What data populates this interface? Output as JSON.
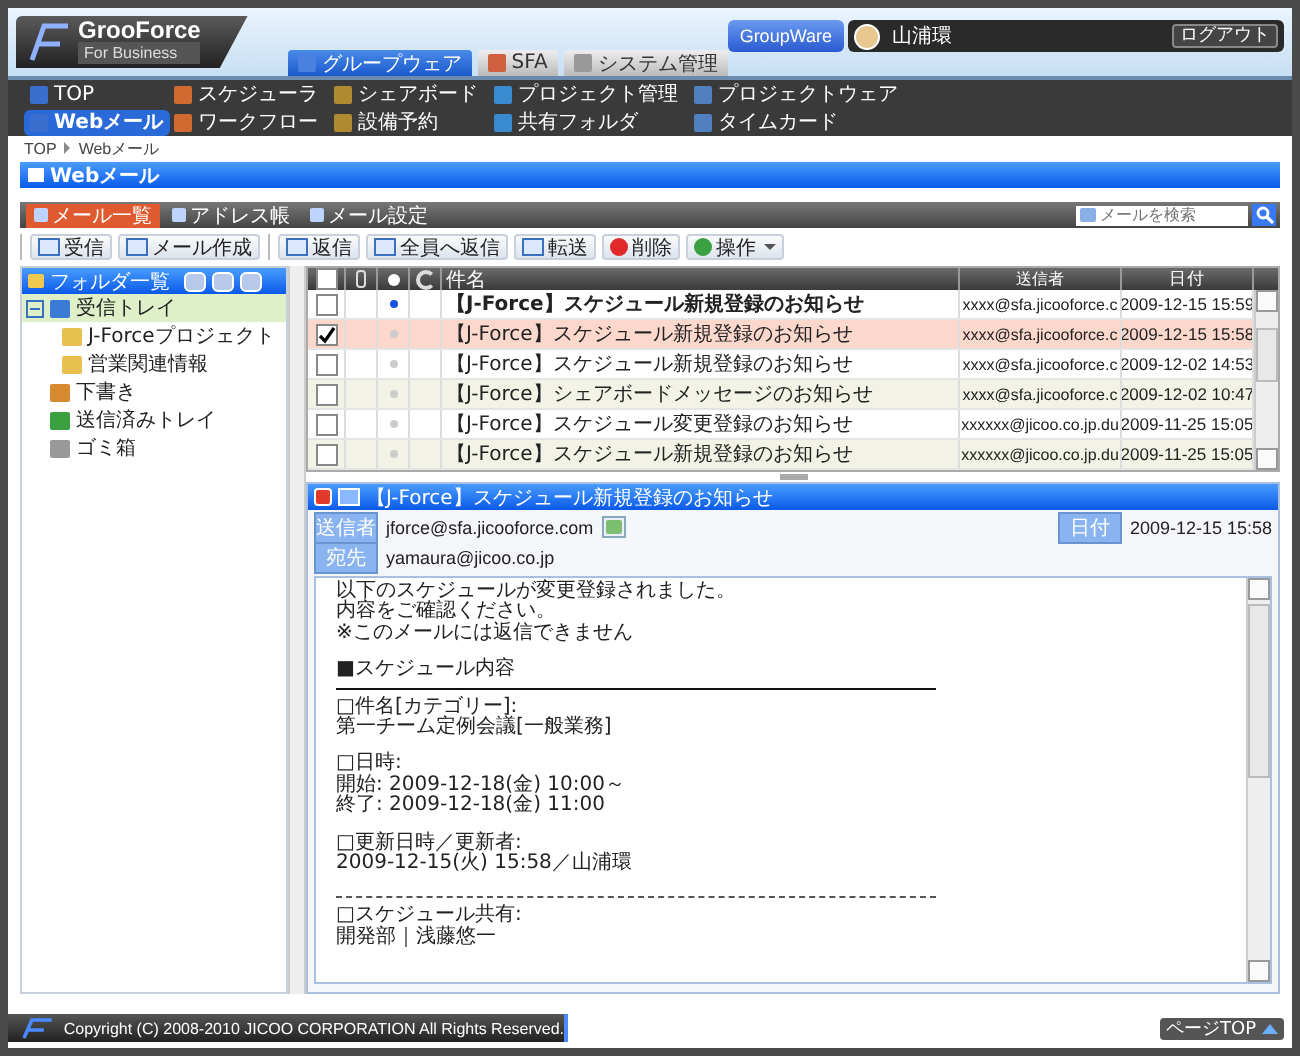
{
  "header": {
    "logo": {
      "name": "GrooForce",
      "tagline": "For Business"
    },
    "groupware_button": "GroupWare",
    "user": "山浦環",
    "logout": "ログアウト"
  },
  "tabs": [
    {
      "label": "グループウェア",
      "selected": true
    },
    {
      "label": "SFA",
      "selected": false
    },
    {
      "label": "システム管理",
      "selected": false
    }
  ],
  "nav": [
    {
      "label": "TOP",
      "selected": false
    },
    {
      "label": "スケジューラ",
      "selected": false
    },
    {
      "label": "シェアボード",
      "selected": false
    },
    {
      "label": "プロジェクト管理",
      "selected": false
    },
    {
      "label": "プロジェクトウェア",
      "selected": false
    },
    {
      "label": "Webメール",
      "selected": true
    },
    {
      "label": "ワークフロー",
      "selected": false
    },
    {
      "label": "設備予約",
      "selected": false
    },
    {
      "label": "共有フォルダ",
      "selected": false
    },
    {
      "label": "タイムカード",
      "selected": false
    }
  ],
  "breadcrumb": [
    "TOP",
    "Webメール"
  ],
  "page_title": "Webメール",
  "subtabs": [
    {
      "label": "メール一覧",
      "selected": true
    },
    {
      "label": "アドレス帳",
      "selected": false
    },
    {
      "label": "メール設定",
      "selected": false
    }
  ],
  "search": {
    "placeholder": "メールを検索"
  },
  "toolbar": [
    [
      {
        "label": "受信",
        "kind": "button"
      },
      {
        "label": "メール作成",
        "kind": "button"
      }
    ],
    [
      {
        "label": "返信",
        "kind": "button"
      },
      {
        "label": "全員へ返信",
        "kind": "button"
      },
      {
        "label": "転送",
        "kind": "button"
      },
      {
        "label": "削除",
        "kind": "delete"
      },
      {
        "label": "操作",
        "kind": "menu"
      }
    ]
  ],
  "folders": {
    "title": "フォルダ一覧",
    "items": [
      {
        "label": "受信トレイ",
        "kind": "inbox",
        "expanded": true,
        "selected": true,
        "children": [
          {
            "label": "J-Forceプロジェクト",
            "kind": "folder",
            "selected": false
          },
          {
            "label": "営業関連情報",
            "kind": "folder",
            "selected": false
          }
        ]
      },
      {
        "label": "下書き",
        "kind": "draft",
        "selected": false
      },
      {
        "label": "送信済みトレイ",
        "kind": "sent",
        "selected": false
      },
      {
        "label": "ゴミ箱",
        "kind": "trash",
        "selected": false
      }
    ]
  },
  "mail_list": {
    "all_checked": false,
    "columns": [
      "件名",
      "送信者",
      "日付"
    ],
    "rows": [
      {
        "subject": "【J-Force】スケジュール新規登録のお知らせ",
        "sender": "xxxx@sfa.jicooforce.c",
        "date": "2009-12-15 15:59",
        "checked": false,
        "unread": true,
        "selected": false
      },
      {
        "subject": "【J-Force】スケジュール新規登録のお知らせ",
        "sender": "xxxx@sfa.jicooforce.c",
        "date": "2009-12-15 15:58",
        "checked": true,
        "unread": false,
        "selected": true
      },
      {
        "subject": "【J-Force】スケジュール新規登録のお知らせ",
        "sender": "xxxx@sfa.jicooforce.c",
        "date": "2009-12-02 14:53",
        "checked": false,
        "unread": false,
        "selected": false
      },
      {
        "subject": "【J-Force】シェアボードメッセージのお知らせ",
        "sender": "xxxx@sfa.jicooforce.c",
        "date": "2009-12-02 10:47",
        "checked": false,
        "unread": false,
        "selected": false
      },
      {
        "subject": "【J-Force】スケジュール変更登録のお知らせ",
        "sender": "xxxxxx@jicoo.co.jp.du",
        "date": "2009-11-25 15:05",
        "checked": false,
        "unread": false,
        "selected": false
      },
      {
        "subject": "【J-Force】スケジュール新規登録のお知らせ",
        "sender": "xxxxxx@jicoo.co.jp.du",
        "date": "2009-11-25 15:05",
        "checked": false,
        "unread": false,
        "selected": false
      }
    ]
  },
  "preview": {
    "subject": "【J-Force】スケジュール新規登録のお知らせ",
    "from_label": "送信者",
    "from": "jforce@sfa.jicooforce.com",
    "date_label": "日付",
    "date": "2009-12-15 15:58",
    "to_label": "宛先",
    "to": "yamaura@jicoo.co.jp",
    "body": [
      {
        "kind": "text",
        "text": "以下のスケジュールが変更登録されました。"
      },
      {
        "kind": "text",
        "text": "内容をご確認ください。"
      },
      {
        "kind": "text",
        "text": "※このメールには返信できません"
      },
      {
        "kind": "gap"
      },
      {
        "kind": "text",
        "text": "■スケジュール内容"
      },
      {
        "kind": "rule"
      },
      {
        "kind": "text",
        "text": "□件名[カテゴリー]:"
      },
      {
        "kind": "text",
        "text": "第一チーム定例会議[一般業務]"
      },
      {
        "kind": "gap"
      },
      {
        "kind": "text",
        "text": "□日時:"
      },
      {
        "kind": "text",
        "text": "開始: 2009-12-18(金) 10:00～"
      },
      {
        "kind": "text",
        "text": "終了: 2009-12-18(金) 11:00"
      },
      {
        "kind": "gap"
      },
      {
        "kind": "text",
        "text": "□更新日時／更新者:"
      },
      {
        "kind": "text",
        "text": "2009-12-15(火) 15:58／山浦環"
      },
      {
        "kind": "gap"
      },
      {
        "kind": "dashed"
      },
      {
        "kind": "text",
        "text": "□スケジュール共有:"
      },
      {
        "kind": "text",
        "text": "開発部｜浅藤悠一"
      }
    ]
  },
  "footer": {
    "copyright": "Copyright (C) 2008-2010 JICOO CORPORATION All Rights Reserved.",
    "page_top": "ページTOP"
  }
}
